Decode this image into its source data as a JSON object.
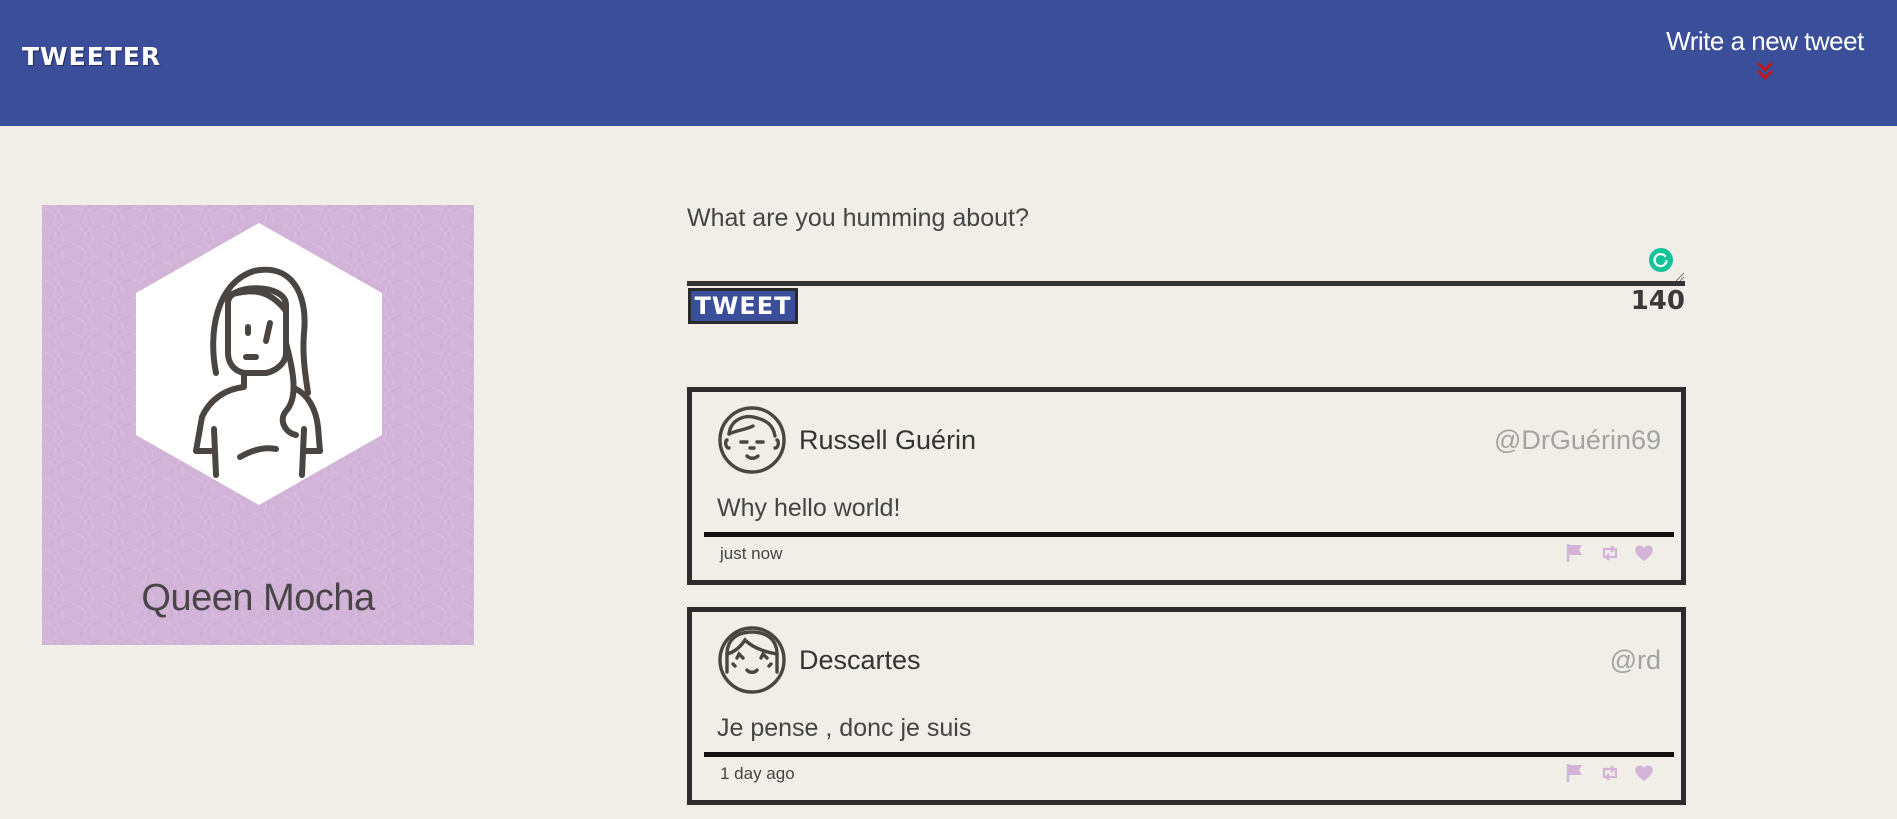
{
  "nav": {
    "brand": "TWEETER",
    "compose_label": "Write a new tweet",
    "compose_icon": "double-chevron-down-icon",
    "compose_icon_color": "#c0181f"
  },
  "colors": {
    "nav_bg": "#3b4e99",
    "page_bg": "#f1eee8",
    "profile_bg": "#d2b4d8",
    "action_icons": "#d3b3d8"
  },
  "profile": {
    "name": "Queen Mocha",
    "avatar_icon": "woman-avatar-icon"
  },
  "compose": {
    "prompt": "What are you humming about?",
    "textarea_value": "",
    "button_label": "TWEET",
    "char_count": "140"
  },
  "tweets": [
    {
      "name": "Russell Guérin",
      "handle": "@DrGuérin69",
      "text": "Why hello world!",
      "time": "just now",
      "avatar_icon": "man-avatar-icon"
    },
    {
      "name": "Descartes",
      "handle": "@rd",
      "text": "Je pense , donc je suis",
      "time": "1 day ago",
      "avatar_icon": "girl-avatar-icon"
    }
  ]
}
